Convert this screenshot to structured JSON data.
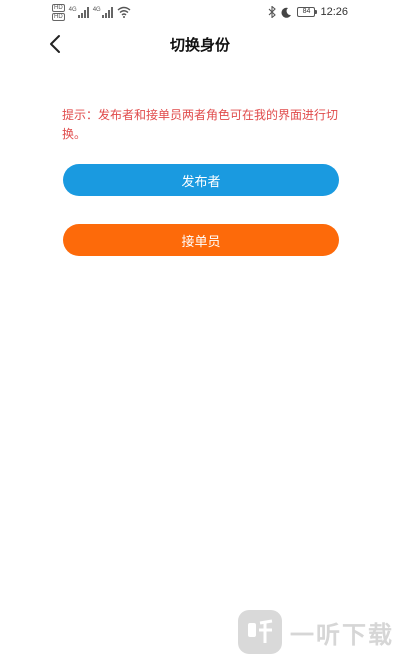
{
  "status_bar": {
    "sim_labels": [
      "HD",
      "HD"
    ],
    "network_labels": [
      "4G",
      "4G"
    ],
    "battery": "84",
    "time": "12:26"
  },
  "header": {
    "title": "切换身份"
  },
  "hint": "提示：发布者和接单员两者角色可在我的界面进行切换。",
  "roles": {
    "publisher_label": "发布者",
    "taker_label": "接单员"
  },
  "watermark": {
    "logo_glyph": "听",
    "text": "一听下载"
  },
  "colors": {
    "publisher": "#1a9ae0",
    "taker": "#fd6a0a",
    "hint": "#e04b4b"
  },
  "icons": [
    "back-arrow-icon",
    "wifi-icon",
    "bluetooth-icon",
    "moon-icon",
    "battery-icon",
    "signal-icon"
  ]
}
